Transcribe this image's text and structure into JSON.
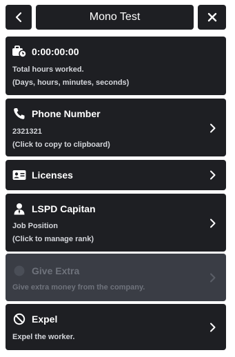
{
  "header": {
    "title": "Mono Test"
  },
  "cards": {
    "hours": {
      "value": "0:00:00:00",
      "line1": "Total hours worked.",
      "line2": "(Days, hours, minutes, seconds)",
      "icon": "briefcase-clock-icon"
    },
    "phone": {
      "title": "Phone Number",
      "line1": "2321321",
      "line2": "(Click to copy to clipboard)",
      "icon": "phone-icon"
    },
    "licenses": {
      "title": "Licenses",
      "icon": "id-card-icon"
    },
    "job": {
      "title": "LSPD Capitan",
      "line1": "Job Position",
      "line2": "(Click to manage rank)",
      "icon": "user-tie-icon"
    },
    "extra": {
      "title": "Give Extra",
      "line1": "Give extra money from the company.",
      "disabled": true
    },
    "expel": {
      "title": "Expel",
      "line1": "Expel the worker.",
      "icon": "ban-icon"
    }
  },
  "colors": {
    "card_bg": "#1e1f23",
    "card_disabled_bg": "#3a3d45",
    "text": "#ffffff",
    "subtext": "#d4d6db",
    "disabled_text": "#6f737c"
  }
}
